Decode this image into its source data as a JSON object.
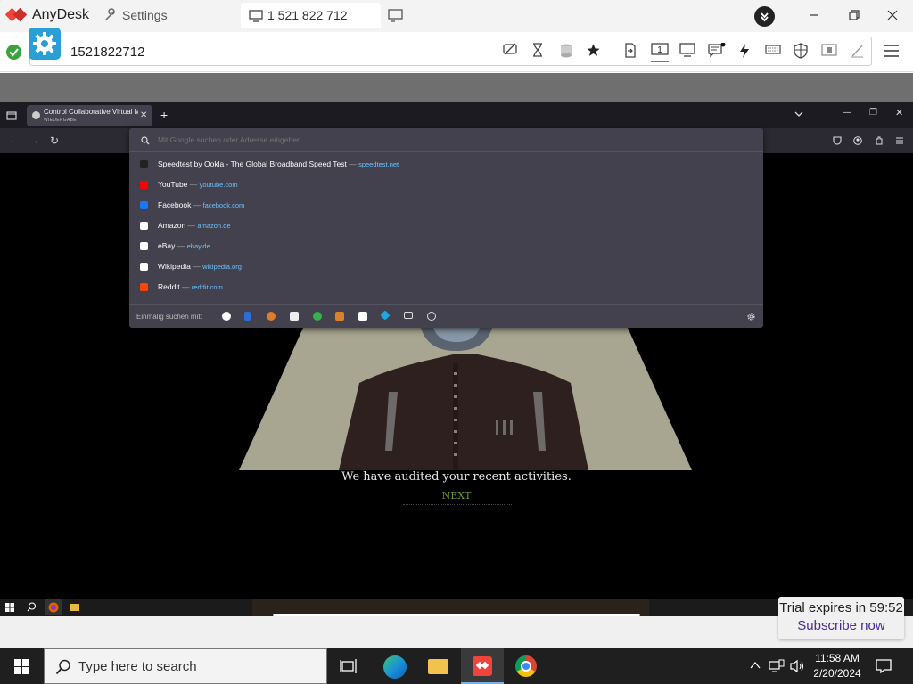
{
  "anydesk": {
    "app_name": "AnyDesk",
    "settings_tab": "Settings",
    "session_tab": "1 521 822 712",
    "address": "1521822712",
    "colors": {
      "brand_red": "#ef443b",
      "accent_blue": "#2a9fd6",
      "connected_green": "#3ca33c"
    },
    "trial": {
      "text": "Trial expires in 59:52",
      "link": "Subscribe now"
    }
  },
  "firefox": {
    "tab": {
      "title": "Control Collaborative Virtual M",
      "subtitle": "WIEDERGABE"
    },
    "url_placeholder": "Mit Google suchen oder Adresse eingeben",
    "suggestions": [
      {
        "title": "Speedtest by Ookla - The Global Broadband Speed Test",
        "url": "speedtest.net",
        "color": "#222222"
      },
      {
        "title": "YouTube",
        "url": "youtube.com",
        "color": "#ff0000"
      },
      {
        "title": "Facebook",
        "url": "facebook.com",
        "color": "#1877f2"
      },
      {
        "title": "Amazon",
        "url": "amazon.de",
        "color": "#ffffff"
      },
      {
        "title": "eBay",
        "url": "ebay.de",
        "color": "#ffffff"
      },
      {
        "title": "Wikipedia",
        "url": "wikipedia.org",
        "color": "#ffffff"
      },
      {
        "title": "Reddit",
        "url": "reddit.com",
        "color": "#ff4500"
      }
    ],
    "separator": "—",
    "oneoff_label": "Einmalig suchen mit:"
  },
  "game": {
    "caption": "We have audited your recent activities.",
    "next_label": "NEXT"
  },
  "windows": {
    "search_placeholder": "Type here to search",
    "time": "11:58 AM",
    "date": "2/20/2024"
  }
}
